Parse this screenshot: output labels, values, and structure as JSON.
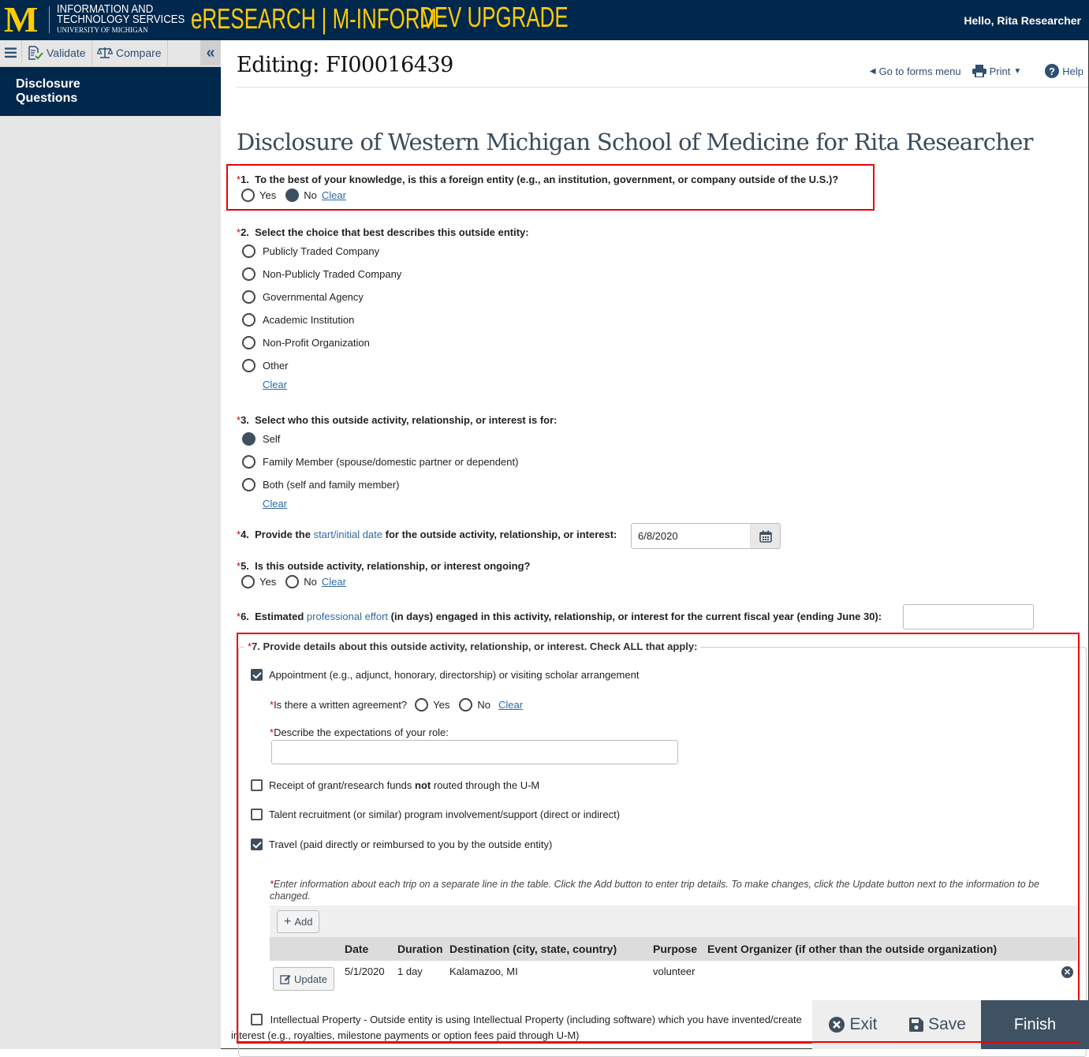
{
  "header": {
    "logo_letter": "M",
    "org_line1": "INFORMATION AND",
    "org_line2": "TECHNOLOGY SERVICES",
    "org_line3": "UNIVERSITY OF MICHIGAN",
    "app_title": "eRESEARCH | M-INFORM",
    "env_label": "DEV UPGRADE",
    "greeting": "Hello, Rita Researcher"
  },
  "toolbar": {
    "validate_label": "Validate",
    "compare_label": "Compare",
    "collapse_glyph": "«"
  },
  "sidebar": {
    "items": [
      {
        "label": "Disclosure Questions",
        "active": true
      }
    ]
  },
  "page": {
    "title": "Editing: FI00016439",
    "go_to_forms_label": "Go to forms menu",
    "print_label": "Print",
    "help_label": "Help",
    "form_title": "Disclosure of Western Michigan School of Medicine for Rita Researcher"
  },
  "questions": {
    "q1": {
      "number": "1.",
      "label": "To the best of your knowledge, is this a foreign entity (e.g., an institution, government, or company outside of the U.S.)?",
      "options": [
        "Yes",
        "No"
      ],
      "selected": "No",
      "clear_label": "Clear"
    },
    "q2": {
      "number": "2.",
      "label": "Select the choice that best describes this outside entity:",
      "options": [
        "Publicly Traded Company",
        "Non-Publicly Traded Company",
        "Governmental Agency",
        "Academic Institution",
        "Non-Profit Organization",
        "Other"
      ],
      "selected": null,
      "clear_label": "Clear"
    },
    "q3": {
      "number": "3.",
      "label": "Select who this outside activity, relationship, or interest is for:",
      "options": [
        "Self",
        "Family Member (spouse/domestic partner or dependent)",
        "Both (self and family member)"
      ],
      "selected": "Self",
      "clear_label": "Clear"
    },
    "q4": {
      "number": "4.",
      "label_pre": "Provide the",
      "label_link": "start/initial date",
      "label_post": "for the outside activity, relationship, or interest:",
      "value": "6/8/2020"
    },
    "q5": {
      "number": "5.",
      "label": "Is this outside activity, relationship, or interest ongoing?",
      "options": [
        "Yes",
        "No"
      ],
      "selected": null,
      "clear_label": "Clear"
    },
    "q6": {
      "number": "6.",
      "label_pre": "Estimated",
      "label_link": "professional effort",
      "label_post": "(in days) engaged in this activity, relationship, or interest for the current fiscal year (ending June 30):",
      "value": ""
    },
    "q7": {
      "number": "7.",
      "label": "Provide details about this outside activity, relationship, or interest. Check ALL that apply:",
      "items": [
        {
          "label": "Appointment (e.g., adjunct, honorary, directorship) or visiting scholar arrangement",
          "checked": true
        },
        {
          "label_pre": "Receipt of grant/research funds",
          "label_bold": "not",
          "label_post": "routed through the U-M",
          "checked": false
        },
        {
          "label": "Talent recruitment (or similar) program involvement/support (direct or indirect)",
          "checked": false
        },
        {
          "label": "Travel (paid directly or reimbursed to you by the outside entity)",
          "checked": true
        },
        {
          "label": "Intellectual Property - Outside entity is using Intellectual Property (including software) which you have invented/create",
          "label_cont": "interest (e.g., royalties, milestone payments or option fees paid through U-M)",
          "checked": false
        }
      ],
      "appointment": {
        "written_agreement_label": "Is there a written agreement?",
        "options": [
          "Yes",
          "No"
        ],
        "selected": null,
        "clear_label": "Clear",
        "expectations_label": "Describe the expectations of your role:",
        "expectations_value": ""
      },
      "travel": {
        "instructions": "Enter information about each trip on a separate line in the table. Click the Add button to enter trip details.  To make changes, click the Update button next to the information to be changed.",
        "add_label": "Add",
        "update_label": "Update",
        "columns": [
          "",
          "Date",
          "Duration",
          "Destination (city, state, country)",
          "Purpose",
          "Event Organizer (if other than the outside organization)",
          ""
        ],
        "rows": [
          {
            "date": "5/1/2020",
            "duration": "1 day",
            "destination": "Kalamazoo, MI",
            "purpose": "volunteer",
            "organizer": ""
          }
        ]
      }
    }
  },
  "footer": {
    "exit_label": "Exit",
    "save_label": "Save",
    "finish_label": "Finish"
  },
  "colors": {
    "brand_navy": "#00274c",
    "brand_maize": "#ffcb05",
    "highlight_red": "#e00000",
    "button_slate": "#3e5263"
  }
}
